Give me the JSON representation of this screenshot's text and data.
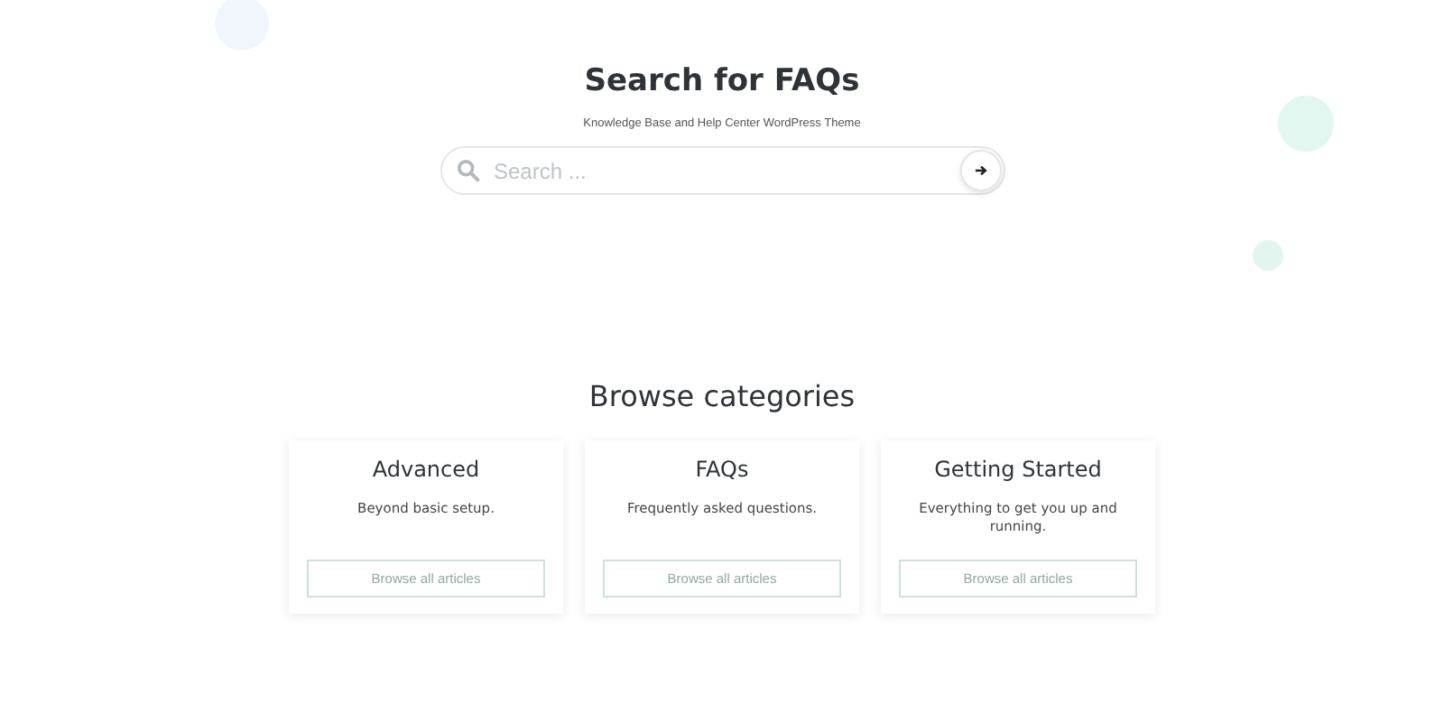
{
  "hero": {
    "title": "Search for FAQs",
    "subtitle": "Knowledge Base and Help Center WordPress Theme",
    "search": {
      "placeholder": "Search ..."
    }
  },
  "browse": {
    "heading": "Browse categories",
    "categories": [
      {
        "title": "Advanced",
        "description": "Beyond basic setup.",
        "button": "Browse all articles"
      },
      {
        "title": "FAQs",
        "description": "Frequently asked questions.",
        "button": "Browse all articles"
      },
      {
        "title": "Getting Started",
        "description": "Everything to get you up and running.",
        "button": "Browse all articles"
      }
    ]
  }
}
